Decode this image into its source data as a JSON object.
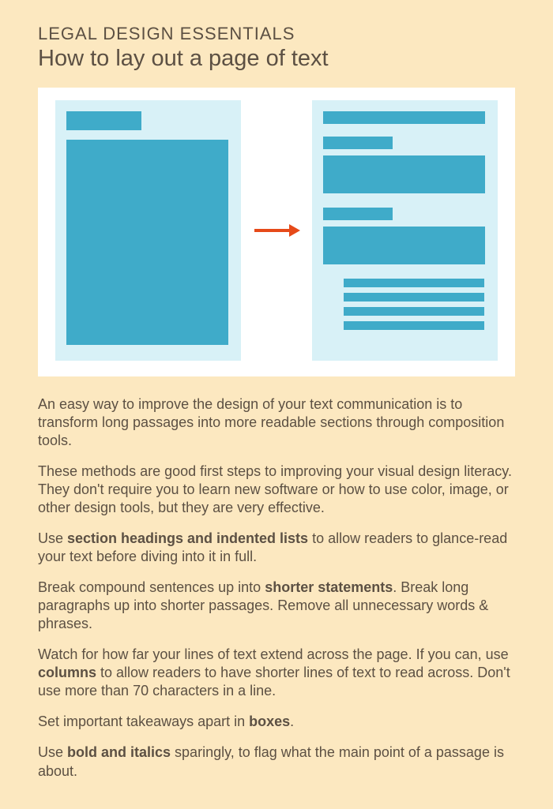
{
  "header": {
    "kicker": "LEGAL DESIGN ESSENTIALS",
    "title": "How to lay out a page of text"
  },
  "body": {
    "p1": "An easy way to improve the design of your text communication is to transform long passages into more readable sections through composition tools.",
    "p2": "These methods are good first steps to improving your visual design literacy. They don't require you to learn new software or how to use color, image, or other design tools, but they are very effective.",
    "p3a": "Use ",
    "p3b": "section headings and indented lists",
    "p3c": " to allow readers to glance-read your text before diving into it in full.",
    "p4a": "Break compound sentences up into ",
    "p4b": "shorter statements",
    "p4c": ". Break long paragraphs up into shorter passages. Remove all unnecessary words & phrases.",
    "p5a": "Watch for how far your lines of text extend across the page. If you can, use ",
    "p5b": "columns",
    "p5c": " to allow readers to have shorter lines of text to read across. Don't use more than 70 characters in a line.",
    "p6a": "Set important takeaways apart in ",
    "p6b": "boxes",
    "p6c": ".",
    "p7a": "Use ",
    "p7b": "bold and italics",
    "p7c": " sparingly, to flag what the main point of a passage is about."
  },
  "colors": {
    "background": "#fce8c0",
    "text": "#5c5043",
    "docBg": "#d8f1f7",
    "block": "#3fabc9",
    "arrow": "#e64a19"
  }
}
